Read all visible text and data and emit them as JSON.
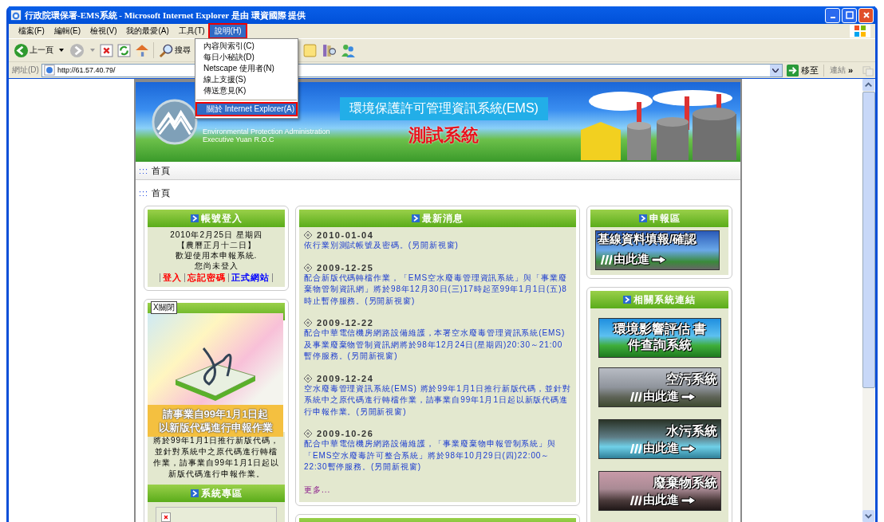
{
  "window": {
    "title": "行政院環保署-EMS系統 - Microsoft Internet Explorer 是由 環資國際 提供"
  },
  "menu_bar": [
    {
      "label": "檔案(F)",
      "selected": false
    },
    {
      "label": "編輯(E)",
      "selected": false
    },
    {
      "label": "檢視(V)",
      "selected": false
    },
    {
      "label": "我的最愛(A)",
      "selected": false
    },
    {
      "label": "工具(T)",
      "selected": false
    },
    {
      "label": "說明(H)",
      "selected": true
    }
  ],
  "help_menu": [
    {
      "label": "內容與索引(C)",
      "selected": false
    },
    {
      "label": "每日小秘訣(D)",
      "selected": false
    },
    {
      "label": "Netscape 使用者(N)",
      "selected": false
    },
    {
      "label": "線上支援(S)",
      "selected": false
    },
    {
      "label": "傳送意見(K)",
      "selected": false
    },
    {
      "label": "關於 Internet Explorer(A)",
      "selected": true
    }
  ],
  "toolbar": {
    "back": "上一頁",
    "search": "搜尋"
  },
  "address_bar": {
    "label": "網址(D)",
    "value": "http://61.57.40.79/",
    "go": "移至",
    "links": "連結",
    "chevron": "»"
  },
  "banner": {
    "org_en": [
      "Environmental Protection Administration",
      "Executive Yuan R.O.C"
    ],
    "title": "環境保護許可管理資訊系統(EMS)",
    "subtitle": "測試系統"
  },
  "breadcrumbs": [
    {
      "marker": ":::",
      "label": "首頁"
    },
    {
      "marker": ":::",
      "label": "首頁"
    }
  ],
  "login_panel": {
    "title": "帳號登入",
    "lines": [
      "2010年2月25日 星期四",
      "【農曆正月十二日】",
      "歡迎使用本申報系統.",
      "您尚未登入"
    ],
    "links": [
      {
        "label": "登入",
        "color": "#ff0000"
      },
      {
        "label": "忘記密碼",
        "color": "#ff0000"
      },
      {
        "label": "正式網站",
        "color": "#0000ff"
      }
    ]
  },
  "focus_panel": {
    "close": "X關閉",
    "popup_caption": [
      "請事業自99年1月1日起",
      "以新版代碼進行申報作業"
    ],
    "text": "將於99年1月1日推行新版代碼，並針對系統中之原代碼進行轉檔作業，請事業自99年1月1日起以新版代碼進行申報作業。"
  },
  "system_panel": {
    "title": "系統專區"
  },
  "news_panel": {
    "title": "最新消息",
    "items": [
      {
        "date": "2010-01-04",
        "text": "依行業別測試帳號及密碼。(另開新視窗)"
      },
      {
        "date": "2009-12-25",
        "text": "配合新版代碼轉檔作業，「EMS空水廢毒管理資訊系統」與「事業廢棄物管制資訊網」將於98年12月30日(三)17時起至99年1月1日(五)8時止暫停服務。(另開新視窗)"
      },
      {
        "date": "2009-12-22",
        "text": "配合中華電信機房網路設備維護，本署空水廢毒管理資訊系統(EMS)及事業廢棄物管制資訊網將於98年12月24日(星期四)20:30～21:00暫停服務。(另開新視窗)"
      },
      {
        "date": "2009-12-24",
        "text": "空水廢毒管理資訊系統(EMS) 將於99年1月1日推行新版代碼，並針對系統中之原代碼進行轉檔作業，請事業自99年1月1日起以新版代碼進行申報作業。(另開新視窗)"
      },
      {
        "date": "2009-10-26",
        "text": "配合中華電信機房網路設備維護，「事業廢棄物申報管制系統」與「EMS空水廢毒許可整合系統」將於98年10月29日(四)22:00～22:30暫停服務。(另開新視窗)"
      }
    ],
    "more": "更多..."
  },
  "report_panel": {
    "title": "申報區",
    "banner": {
      "title": "基線資料填報/確認",
      "enter": "由此進"
    }
  },
  "links_panel": {
    "title": "相關系統連結",
    "banners": [
      {
        "kind": "title",
        "title": "環境影響評估 書件查詢系統"
      },
      {
        "kind": "enter",
        "title": "空污系統",
        "enter": "由此進"
      },
      {
        "kind": "enter",
        "title": "水污系統",
        "enter": "由此進"
      },
      {
        "kind": "enter",
        "title": "廢棄物系統",
        "enter": "由此進"
      }
    ]
  }
}
